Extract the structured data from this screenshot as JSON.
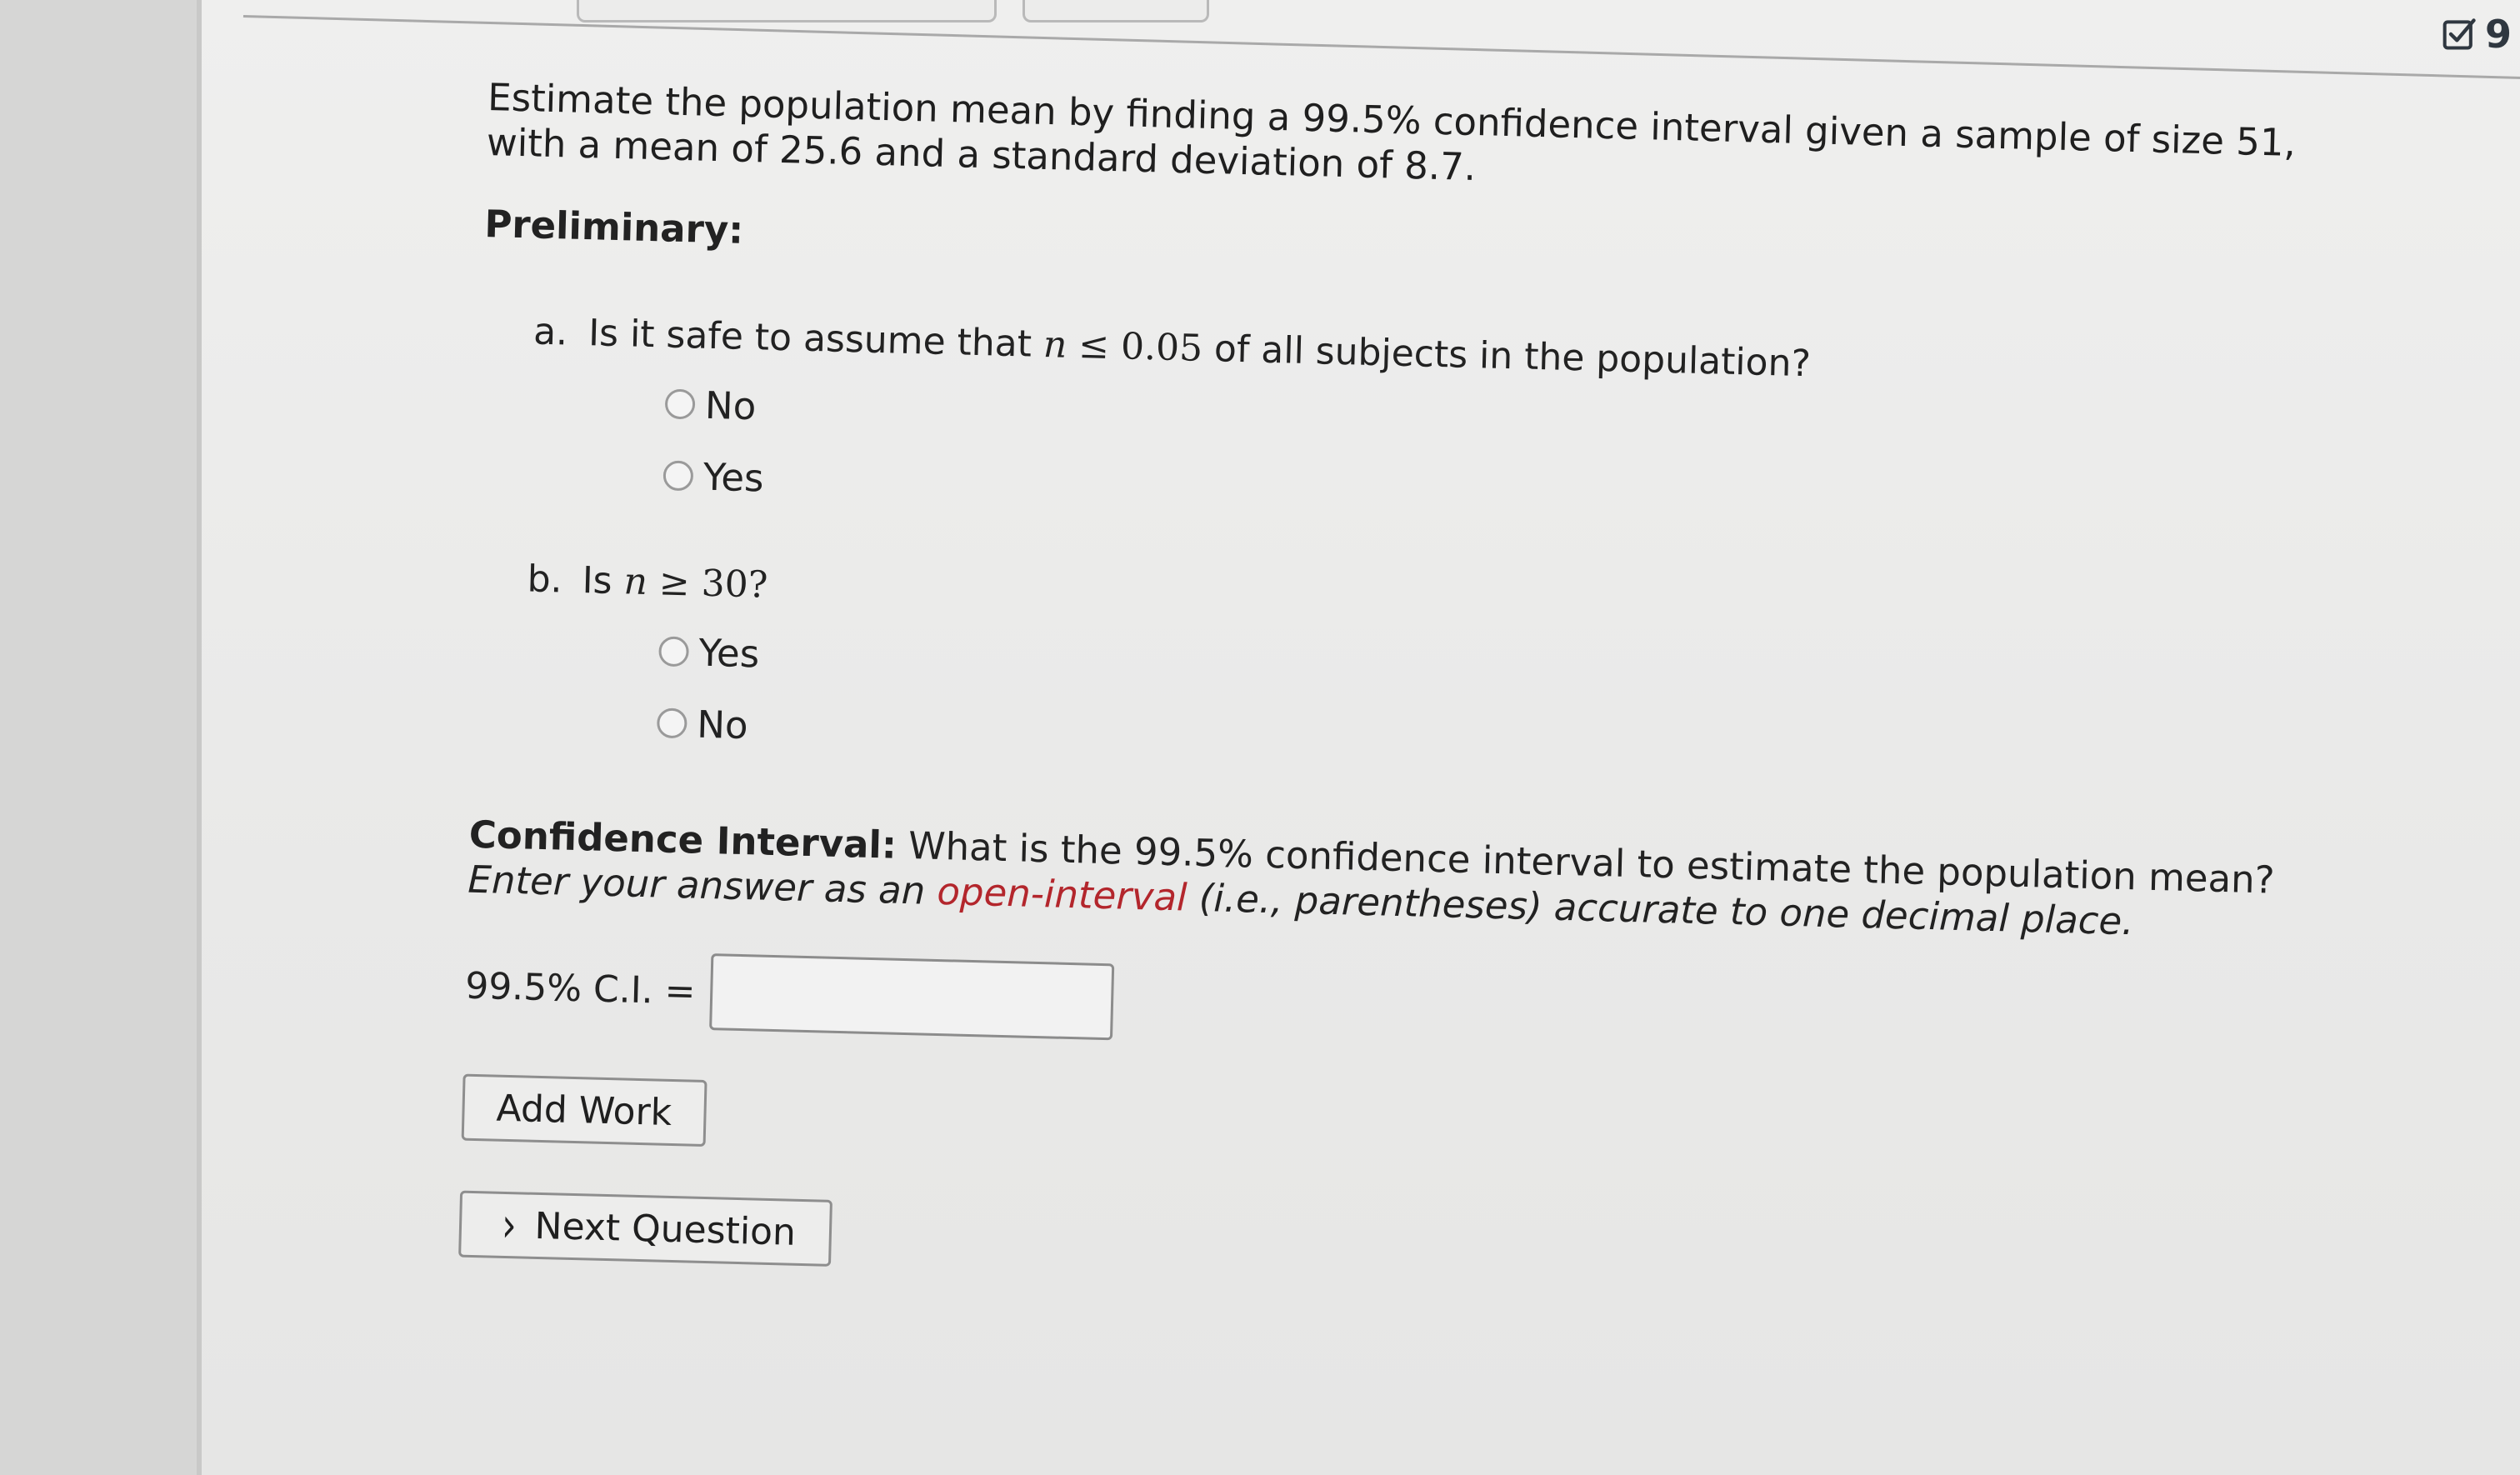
{
  "header": {
    "icon": "checkbox-check-icon",
    "count_text": "9"
  },
  "problem": {
    "intro": "Estimate the population mean by finding a 99.5% confidence interval given a sample of size 51, with a mean of 25.6 and a standard deviation of 8.7.",
    "preliminary_heading": "Preliminary:"
  },
  "question_a": {
    "letter": "a.",
    "text_before": "Is it safe to assume that",
    "math_var": "n",
    "math_rel": " ≤ 0.05",
    "text_after": "of all subjects in the population?",
    "options": [
      "No",
      "Yes"
    ]
  },
  "question_b": {
    "letter": "b.",
    "text_before": "Is",
    "math_var": "n",
    "math_rel": " ≥ 30?",
    "options": [
      "Yes",
      "No"
    ]
  },
  "confidence_interval": {
    "label_bold": "Confidence Interval:",
    "text": "What is the 99.5% confidence interval to estimate the population mean?",
    "instruction_1": "Enter your answer as an",
    "instruction_link": "open-interval",
    "instruction_2": "(i.e., parentheses) accurate to one decimal place.",
    "answer_label": "99.5% C.I. =",
    "answer_value": ""
  },
  "buttons": {
    "add_work": "Add Work",
    "next_question": "Next Question"
  }
}
